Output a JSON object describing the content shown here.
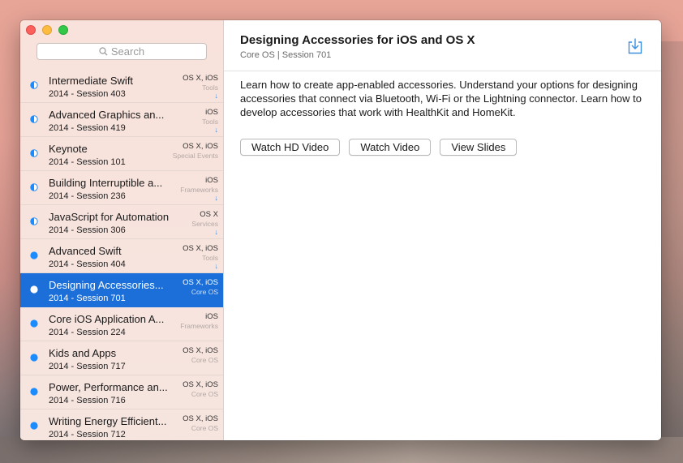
{
  "search": {
    "placeholder": "Search"
  },
  "sessions": [
    {
      "title": "Intermediate Swift",
      "subtitle": "2014 - Session 403",
      "platform": "OS X, iOS",
      "track": "Tools",
      "status": "half",
      "download": "↓"
    },
    {
      "title": "Advanced Graphics an...",
      "subtitle": "2014 - Session 419",
      "platform": "iOS",
      "track": "Tools",
      "status": "half",
      "download": "↓"
    },
    {
      "title": "Keynote",
      "subtitle": "2014 - Session 101",
      "platform": "OS X, iOS",
      "track": "Special Events",
      "status": "half",
      "download": ""
    },
    {
      "title": "Building Interruptible a...",
      "subtitle": "2014 - Session 236",
      "platform": "iOS",
      "track": "Frameworks",
      "status": "half",
      "download": "↓"
    },
    {
      "title": "JavaScript for Automation",
      "subtitle": "2014 - Session 306",
      "platform": "OS X",
      "track": "Services",
      "status": "half",
      "download": "↓"
    },
    {
      "title": "Advanced Swift",
      "subtitle": "2014 - Session 404",
      "platform": "OS X, iOS",
      "track": "Tools",
      "status": "full",
      "download": "↓"
    },
    {
      "title": "Designing Accessories...",
      "subtitle": "2014 - Session 701",
      "platform": "OS X, iOS",
      "track": "Core OS",
      "status": "full",
      "download": "",
      "selected": true
    },
    {
      "title": "Core iOS Application A...",
      "subtitle": "2014 - Session 224",
      "platform": "iOS",
      "track": "Frameworks",
      "status": "full",
      "download": ""
    },
    {
      "title": "Kids and Apps",
      "subtitle": "2014 - Session 717",
      "platform": "OS X, iOS",
      "track": "Core OS",
      "status": "full",
      "download": ""
    },
    {
      "title": "Power, Performance an...",
      "subtitle": "2014 - Session 716",
      "platform": "OS X, iOS",
      "track": "Core OS",
      "status": "full",
      "download": ""
    },
    {
      "title": "Writing Energy Efficient...",
      "subtitle": "2014 - Session 712",
      "platform": "OS X, iOS",
      "track": "Core OS",
      "status": "full",
      "download": ""
    }
  ],
  "detail": {
    "title": "Designing Accessories for iOS and OS X",
    "subtitle": "Core OS | Session 701",
    "description": "Learn how to create app-enabled accessories. Understand your options for designing accessories that connect via Bluetooth, Wi-Fi or the Lightning connector. Learn how to develop accessories that work with HealthKit and HomeKit.",
    "buttons": {
      "hd_video": "Watch HD Video",
      "video": "Watch Video",
      "slides": "View Slides"
    },
    "download_icon": "download-icon"
  },
  "colors": {
    "accent": "#1c6fd9",
    "dot": "#1a8cff",
    "download": "#3d8fe0"
  }
}
